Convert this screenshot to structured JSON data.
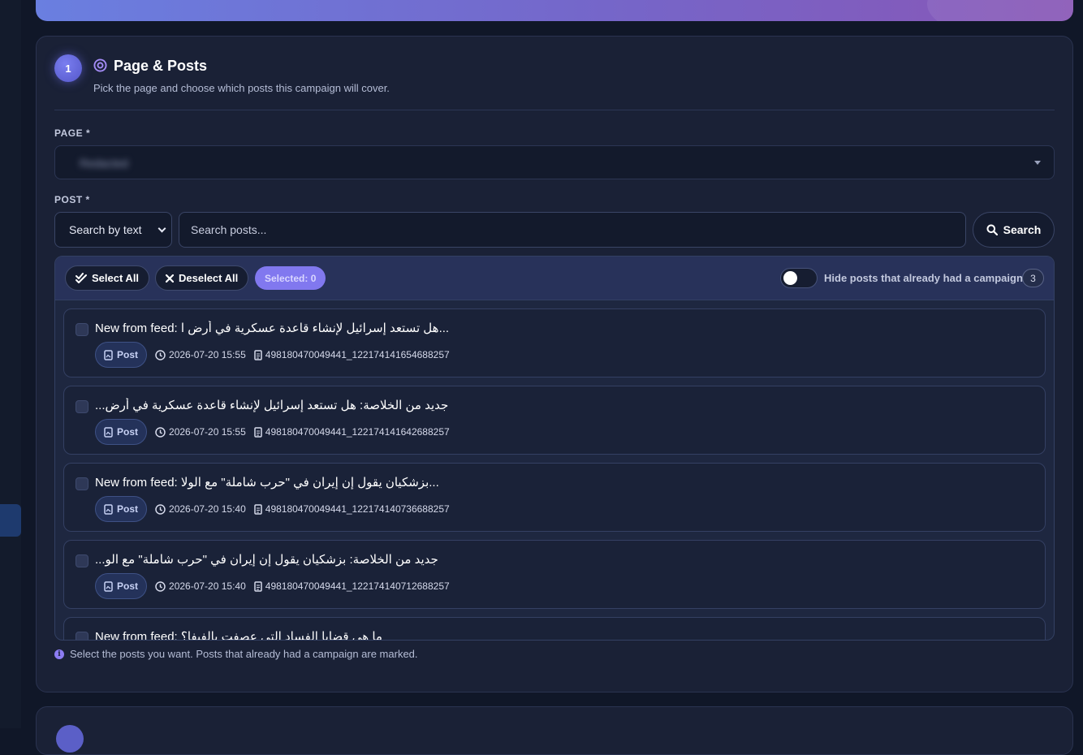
{
  "card": {
    "step_number": "1",
    "title": "Page & Posts",
    "subtitle": "Pick the page and choose which posts this campaign will cover.",
    "page_label": "PAGE *",
    "page_value": "Redacted",
    "post_label": "POST *",
    "search_mode": "Search by text",
    "search_placeholder": "Search posts...",
    "search_button": "Search"
  },
  "toolbar": {
    "select_all": "Select All",
    "deselect_all": "Deselect All",
    "selected": "Selected: 0",
    "hide_label": "Hide posts that already had a campaign",
    "hide_count": "3"
  },
  "posts": [
    {
      "title": "New from feed: هل تستعد إسرائيل لإنشاء قاعدة عسكرية في أرض ا...",
      "badge": "Post",
      "time": "2026-07-20 15:55",
      "id": "498180470049441_122174141654688257"
    },
    {
      "title": "جديد من الخلاصة: هل تستعد إسرائيل لإنشاء قاعدة عسكرية في أرض...",
      "badge": "Post",
      "time": "2026-07-20 15:55",
      "id": "498180470049441_122174141642688257"
    },
    {
      "title": "New from feed: بزشكيان يقول إن إيران في \"حرب شاملة\" مع الولا...",
      "badge": "Post",
      "time": "2026-07-20 15:40",
      "id": "498180470049441_122174140736688257"
    },
    {
      "title": "جديد من الخلاصة: بزشكيان يقول إن إيران في \"حرب شاملة\" مع الو...",
      "badge": "Post",
      "time": "2026-07-20 15:40",
      "id": "498180470049441_122174140712688257"
    },
    {
      "title": "New from feed: ما هي قضايا الفساد التي عصفت بالفيفا؟",
      "badge": "",
      "time": "",
      "id": ""
    }
  ],
  "hint": "Select the posts you want. Posts that already had a campaign are marked.",
  "colors": {
    "accent": "#8178ef",
    "card_bg": "#1a2136",
    "page_bg": "#101728"
  }
}
